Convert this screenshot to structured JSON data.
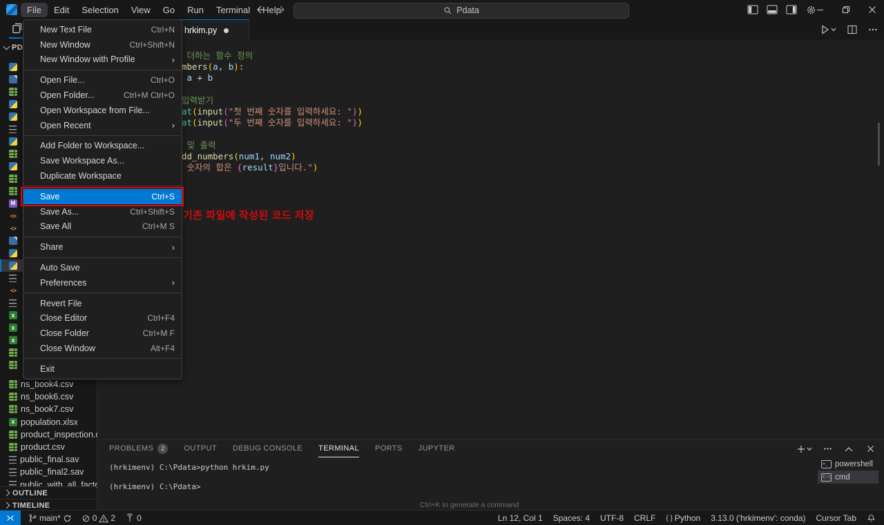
{
  "titlebar": {
    "menus": [
      "File",
      "Edit",
      "Selection",
      "View",
      "Go",
      "Run",
      "Terminal",
      "Help"
    ],
    "active_menu_index": 0,
    "search_text": "Pdata"
  },
  "file_menu": {
    "groups": [
      [
        {
          "label": "New Text File",
          "shortcut": "Ctrl+N"
        },
        {
          "label": "New Window",
          "shortcut": "Ctrl+Shift+N"
        },
        {
          "label": "New Window with Profile",
          "submenu": true
        }
      ],
      [
        {
          "label": "Open File...",
          "shortcut": "Ctrl+O"
        },
        {
          "label": "Open Folder...",
          "shortcut": "Ctrl+M Ctrl+O"
        },
        {
          "label": "Open Workspace from File..."
        },
        {
          "label": "Open Recent",
          "submenu": true
        }
      ],
      [
        {
          "label": "Add Folder to Workspace..."
        },
        {
          "label": "Save Workspace As..."
        },
        {
          "label": "Duplicate Workspace"
        }
      ],
      [
        {
          "label": "Save",
          "shortcut": "Ctrl+S",
          "highlighted": true
        },
        {
          "label": "Save As...",
          "shortcut": "Ctrl+Shift+S"
        },
        {
          "label": "Save All",
          "shortcut": "Ctrl+M S"
        }
      ],
      [
        {
          "label": "Share",
          "submenu": true
        }
      ],
      [
        {
          "label": "Auto Save"
        },
        {
          "label": "Preferences",
          "submenu": true
        }
      ],
      [
        {
          "label": "Revert File"
        },
        {
          "label": "Close Editor",
          "shortcut": "Ctrl+F4"
        },
        {
          "label": "Close Folder",
          "shortcut": "Ctrl+M F"
        },
        {
          "label": "Close Window",
          "shortcut": "Alt+F4"
        }
      ],
      [
        {
          "label": "Exit"
        }
      ]
    ],
    "highlight_color": "#0078d4",
    "annotation_box_color": "#ee0000"
  },
  "annotation": {
    "text": "기존 파일에 작성된 코드 저장",
    "color": "#d40b0b"
  },
  "sidebar": {
    "folder_label": "PDATA",
    "icon_rows": [
      "py",
      "ipynb",
      "csv",
      "py",
      "py",
      "sav",
      "py",
      "csv",
      "py",
      "csv",
      "csv",
      "md",
      "code",
      "code",
      "ipynb",
      "py",
      "py",
      "sav",
      "code",
      "sav",
      "xlsx",
      "xlsx",
      "xlsx",
      "csv",
      "csv"
    ],
    "selected_icon_row": 16,
    "files": [
      {
        "name": "ns_book4.csv",
        "type": "csv"
      },
      {
        "name": "ns_book6.csv",
        "type": "csv"
      },
      {
        "name": "ns_book7.csv",
        "type": "csv"
      },
      {
        "name": "population.xlsx",
        "type": "xlsx"
      },
      {
        "name": "product_inspection.csv",
        "type": "csv"
      },
      {
        "name": "product.csv",
        "type": "csv"
      },
      {
        "name": "public_final.sav",
        "type": "sav"
      },
      {
        "name": "public_final2.sav",
        "type": "sav"
      },
      {
        "name": "public_with_all_factor",
        "type": "sav"
      }
    ],
    "sections": [
      {
        "label": "OUTLINE"
      },
      {
        "label": "TIMELINE"
      }
    ]
  },
  "editor": {
    "tab_label": "hrkim.py",
    "tab_modified": true,
    "token_colors": {
      "comment": "#6A9955",
      "func": "#DCDCAA",
      "var": "#9CDCFE",
      "fg": "#d4d4d4",
      "str": "#CE9178",
      "b1": "#FFD700",
      "b2": "#DA70D6",
      "type": "#4EC9B0"
    },
    "code_lines": [
      {
        "segments": [
          [
            " 더하는 함수 정의",
            "comment"
          ]
        ]
      },
      {
        "segments": [
          [
            "mbers",
            "func"
          ],
          [
            "(",
            "b1"
          ],
          [
            "a",
            "var"
          ],
          [
            ",",
            "fg"
          ],
          [
            " b",
            "var"
          ],
          [
            ")",
            "b1"
          ],
          [
            ":",
            "fg"
          ]
        ]
      },
      {
        "segments": [
          [
            " a",
            "var"
          ],
          [
            " + ",
            "fg"
          ],
          [
            "b",
            "var"
          ]
        ]
      },
      {
        "segments": []
      },
      {
        "segments": [
          [
            "입력받기",
            "comment"
          ]
        ]
      },
      {
        "segments": [
          [
            "at",
            "type"
          ],
          [
            "(",
            "b1"
          ],
          [
            "input",
            "func"
          ],
          [
            "(",
            "b2"
          ],
          [
            "\"첫 번째 숫자를 입력하세요: \"",
            "str"
          ],
          [
            ")",
            "b2"
          ],
          [
            ")",
            "b1"
          ]
        ]
      },
      {
        "segments": [
          [
            "at",
            "type"
          ],
          [
            "(",
            "b1"
          ],
          [
            "input",
            "func"
          ],
          [
            "(",
            "b2"
          ],
          [
            "\"두 번째 숫자를 입력하세요: \"",
            "str"
          ],
          [
            ")",
            "b2"
          ],
          [
            ")",
            "b1"
          ]
        ]
      },
      {
        "segments": []
      },
      {
        "segments": [
          [
            " 및 출력",
            "comment"
          ]
        ]
      },
      {
        "segments": [
          [
            "dd_numbers",
            "func"
          ],
          [
            "(",
            "b1"
          ],
          [
            "num1",
            "var"
          ],
          [
            ",",
            "fg"
          ],
          [
            " num2",
            "var"
          ],
          [
            ")",
            "b1"
          ]
        ]
      },
      {
        "segments": [
          [
            " 숫자의 합은 ",
            "str"
          ],
          [
            "{",
            "b2"
          ],
          [
            "result",
            "var"
          ],
          [
            "}",
            "b2"
          ],
          [
            "입니다.\"",
            "str"
          ],
          [
            ")",
            "b1"
          ]
        ]
      }
    ]
  },
  "panel": {
    "tabs": [
      {
        "label": "PROBLEMS",
        "badge": "2"
      },
      {
        "label": "OUTPUT"
      },
      {
        "label": "DEBUG CONSOLE"
      },
      {
        "label": "TERMINAL",
        "active": true
      },
      {
        "label": "PORTS"
      },
      {
        "label": "JUPYTER"
      }
    ],
    "terminal_lines": [
      "(hrkimenv) C:\\Pdata>python hrkim.py",
      "(hrkimenv) C:\\Pdata>"
    ],
    "hint": "Ctrl+K to generate a command",
    "terminal_list": [
      {
        "name": "powershell",
        "selected": false
      },
      {
        "name": "cmd",
        "selected": true
      }
    ]
  },
  "statusbar": {
    "branch": "main*",
    "errors": "0",
    "warnings": "2",
    "ports": "0",
    "right_items": [
      "Ln 12, Col 1",
      "Spaces: 4",
      "UTF-8",
      "CRLF",
      "Python",
      "3.13.0 ('hrkimenv': conda)",
      "Cursor Tab"
    ]
  }
}
